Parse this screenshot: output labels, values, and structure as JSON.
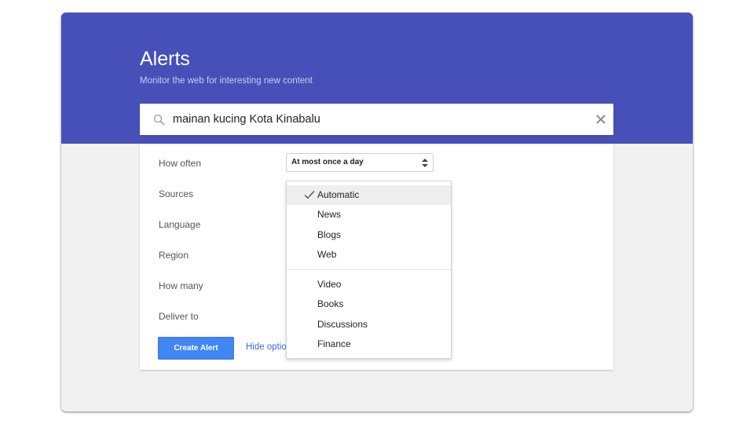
{
  "header": {
    "title": "Alerts",
    "subtitle": "Monitor the web for interesting new content",
    "background_color": "#4650b8"
  },
  "search": {
    "icon": "search-icon",
    "query": "mainan kucing Kota Kinabalu",
    "clear_icon": "close-icon"
  },
  "options": {
    "how_often_label": "How often",
    "how_often_value": "At most once a day",
    "sources_label": "Sources",
    "language_label": "Language",
    "region_label": "Region",
    "how_many_label": "How many",
    "deliver_to_label": "Deliver to"
  },
  "actions": {
    "create_label": "Create Alert",
    "hide_options_label": "Hide options",
    "create_color": "#4285f4"
  },
  "sources_dropdown": {
    "items": [
      {
        "label": "Automatic",
        "selected": true
      },
      {
        "label": "News",
        "selected": false
      },
      {
        "label": "Blogs",
        "selected": false
      },
      {
        "label": "Web",
        "selected": false
      },
      {
        "label": "Video",
        "selected": false
      },
      {
        "label": "Books",
        "selected": false
      },
      {
        "label": "Discussions",
        "selected": false
      },
      {
        "label": "Finance",
        "selected": false
      }
    ]
  }
}
